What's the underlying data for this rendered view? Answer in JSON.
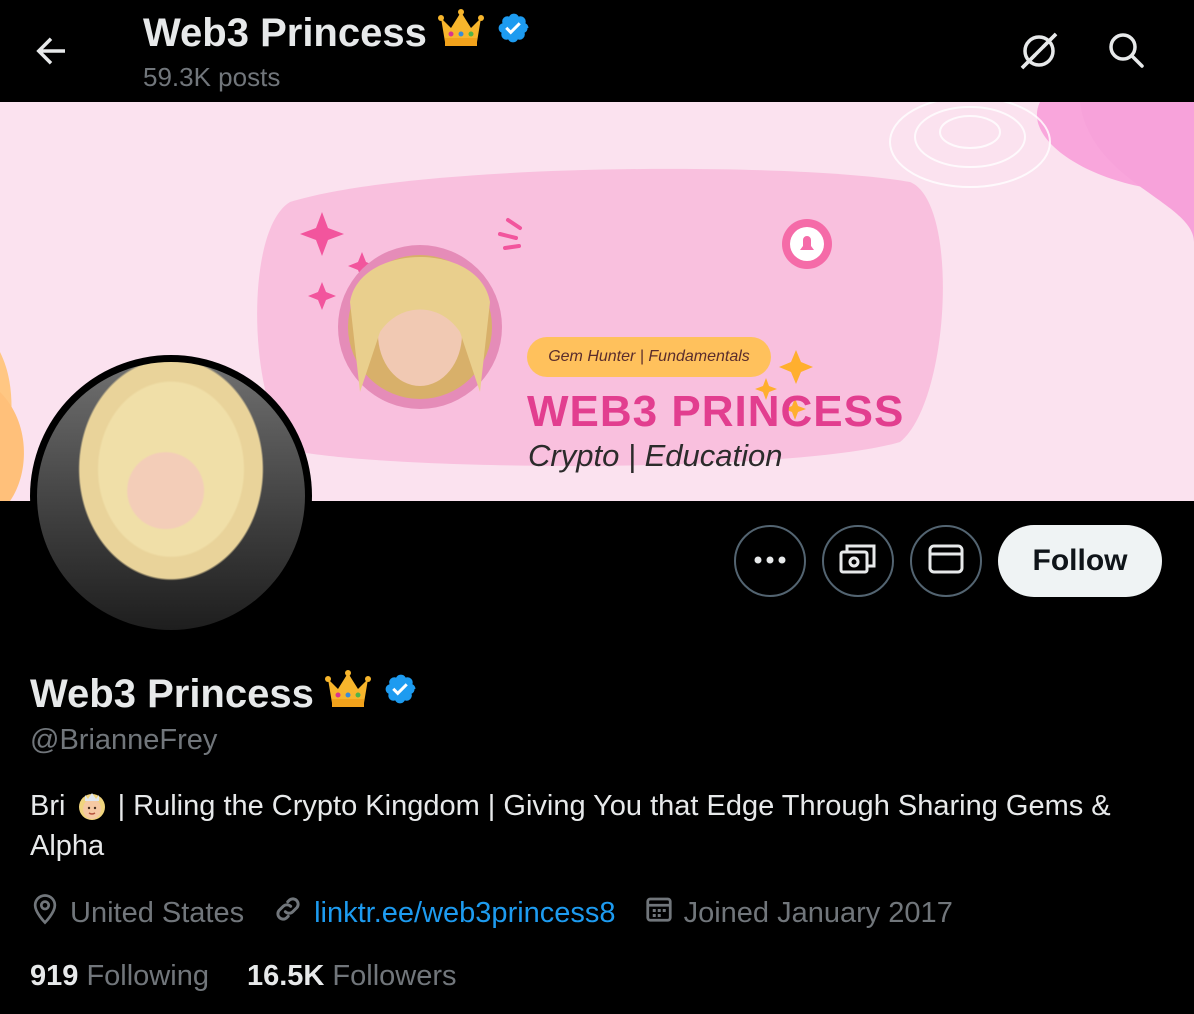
{
  "header": {
    "title": "Web3 Princess",
    "posts_count": "59.3K posts"
  },
  "banner": {
    "tag": "Gem Hunter | Fundamentals",
    "title": "WEB3 PRINCESS",
    "subtitle": "Crypto | Education"
  },
  "profile": {
    "name": "Web3 Princess",
    "handle": "@BrianneFrey",
    "bio_prefix": "Bri",
    "bio_text": "| Ruling the Crypto Kingdom | Giving You that Edge Through Sharing Gems & Alpha",
    "location": "United States",
    "website": "linktr.ee/web3princess8",
    "joined": "Joined January 2017",
    "following_count": "919",
    "following_label": "Following",
    "followers_count": "16.5K",
    "followers_label": "Followers"
  },
  "actions": {
    "follow_label": "Follow"
  },
  "colors": {
    "accent": "#1d9bf0",
    "verified": "#1d9bf0",
    "banner_pink": "#fbe2ef",
    "brand_pink": "#e23e8f"
  },
  "icons": [
    "back-arrow-icon",
    "grok-icon",
    "search-icon",
    "more-icon",
    "tip-icon",
    "message-icon",
    "location-icon",
    "link-icon",
    "calendar-icon",
    "verified-badge-icon",
    "crown-icon",
    "princess-emoji-icon"
  ]
}
